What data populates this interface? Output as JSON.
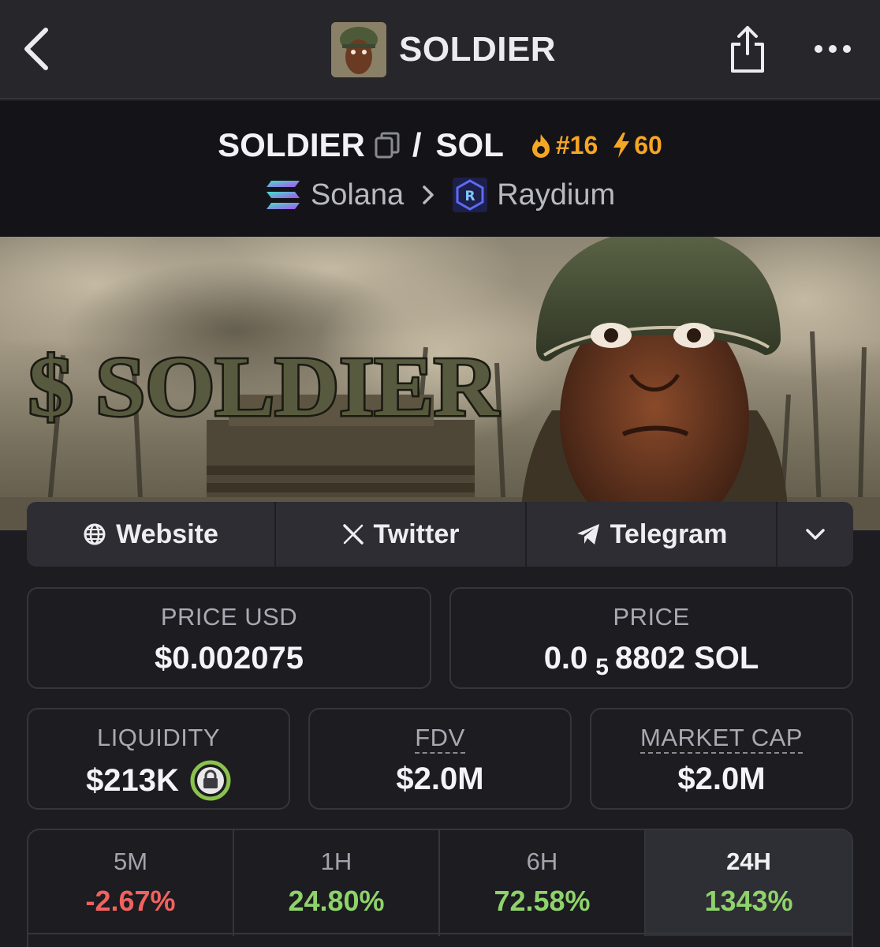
{
  "nav": {
    "title": "SOLDIER"
  },
  "pair": {
    "base": "SOLDIER",
    "separator": "/",
    "quote": "SOL",
    "rank": "#16",
    "boost": "60",
    "chain": "Solana",
    "dex": "Raydium"
  },
  "banner": {
    "text": "$ SOLDIER"
  },
  "socials": {
    "website": "Website",
    "twitter": "Twitter",
    "telegram": "Telegram"
  },
  "stats": {
    "price_usd_label": "PRICE USD",
    "price_usd": "$0.002075",
    "price_label": "PRICE",
    "price_prefix": "0.0",
    "price_zeros": "5",
    "price_suffix": "8802 SOL",
    "liquidity_label": "LIQUIDITY",
    "liquidity": "$213K",
    "fdv_label": "FDV",
    "fdv": "$2.0M",
    "mcap_label": "MARKET CAP",
    "mcap": "$2.0M"
  },
  "timeframes": [
    {
      "label": "5M",
      "value": "-2.67%",
      "direction": "down"
    },
    {
      "label": "1H",
      "value": "24.80%",
      "direction": "up"
    },
    {
      "label": "6H",
      "value": "72.58%",
      "direction": "up"
    },
    {
      "label": "24H",
      "value": "1343%",
      "direction": "up",
      "active": true
    }
  ],
  "colors": {
    "accent_orange": "#f5a623",
    "positive": "#8ed36a",
    "negative": "#f0625e",
    "lock_green": "#8bc34a"
  }
}
